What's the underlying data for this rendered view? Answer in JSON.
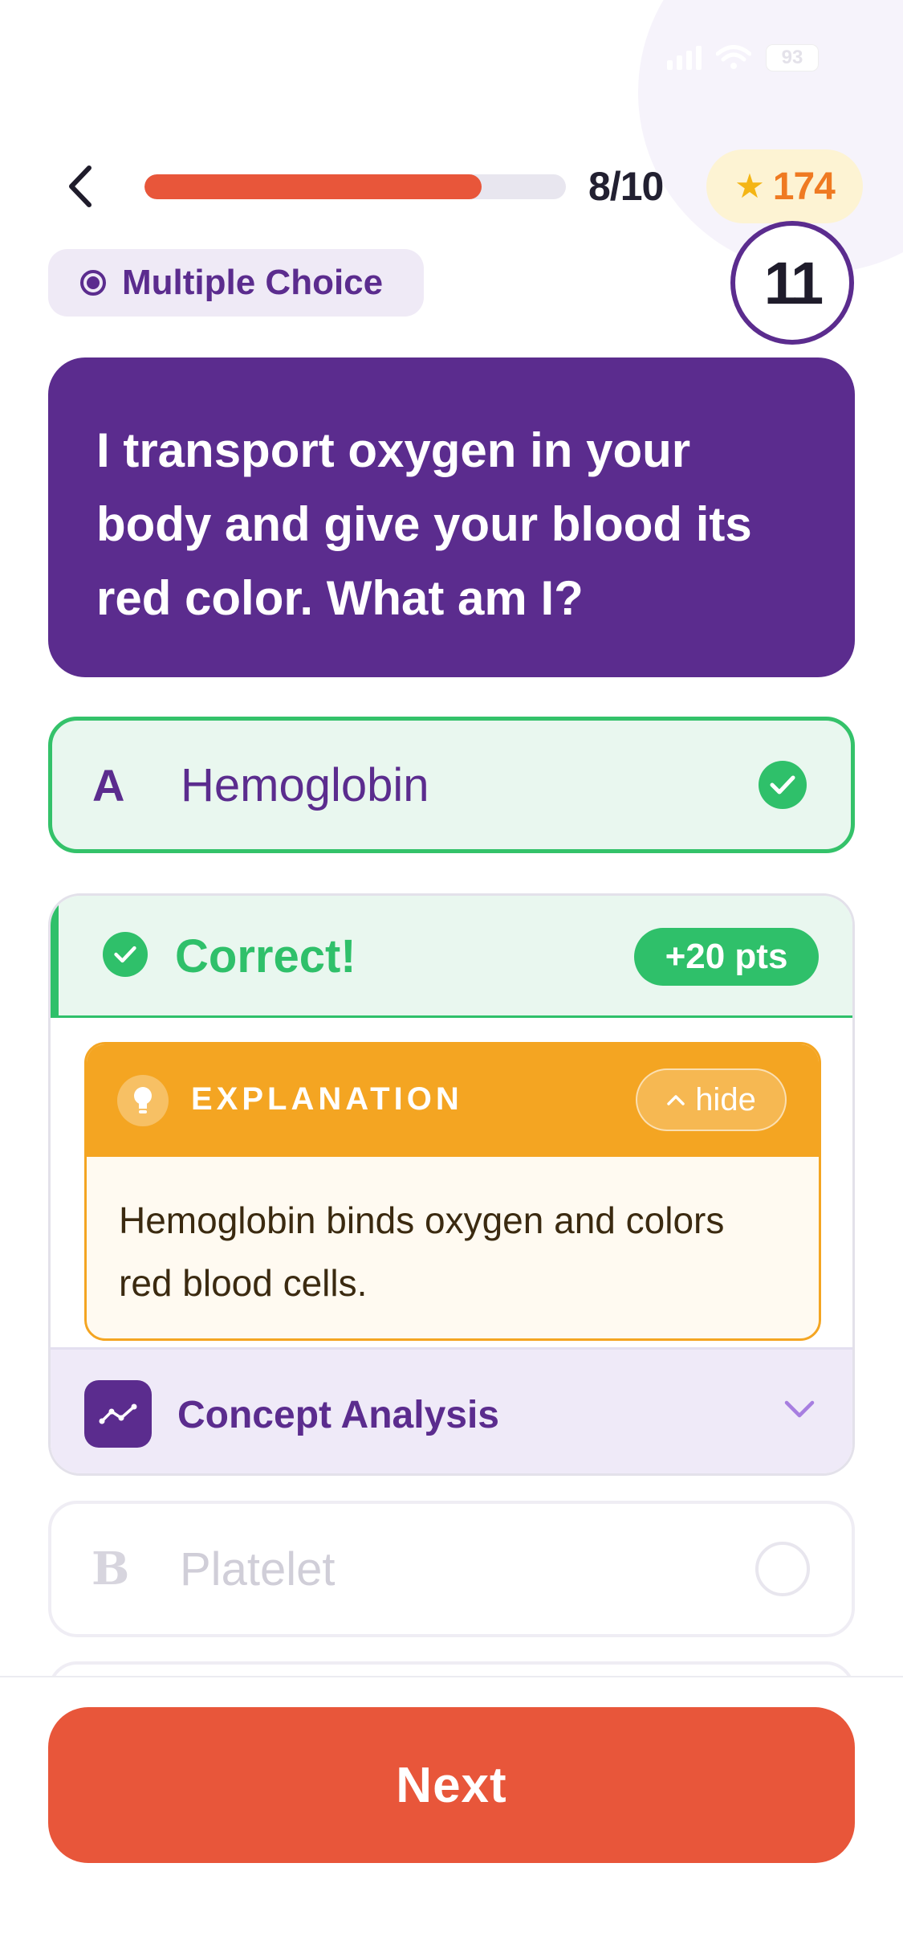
{
  "status_bar": {
    "battery": "93"
  },
  "header": {
    "progress_label": "8/10",
    "progress_fraction": 0.8,
    "score": "174"
  },
  "question": {
    "type_label": "Multiple Choice",
    "timer": "11",
    "text": "I transport oxygen in your body and give your blood its red color. What am I?"
  },
  "options": [
    {
      "letter": "A",
      "text": "Hemoglobin",
      "state": "correct"
    },
    {
      "letter": "B",
      "text": "Platelet",
      "state": "unselected"
    }
  ],
  "feedback": {
    "title": "Correct!",
    "points": "+20 pts",
    "explanation_title": "EXPLANATION",
    "hide_label": "hide",
    "explanation_text": "Hemoglobin binds oxygen and colors red blood cells.",
    "concept_label": "Concept Analysis"
  },
  "footer": {
    "next_label": "Next"
  },
  "colors": {
    "primary_purple": "#5b2c8e",
    "accent_orange": "#e8563a",
    "success_green": "#2fc06a",
    "explain_amber": "#f4a522",
    "star_gold": "#f4b515"
  }
}
